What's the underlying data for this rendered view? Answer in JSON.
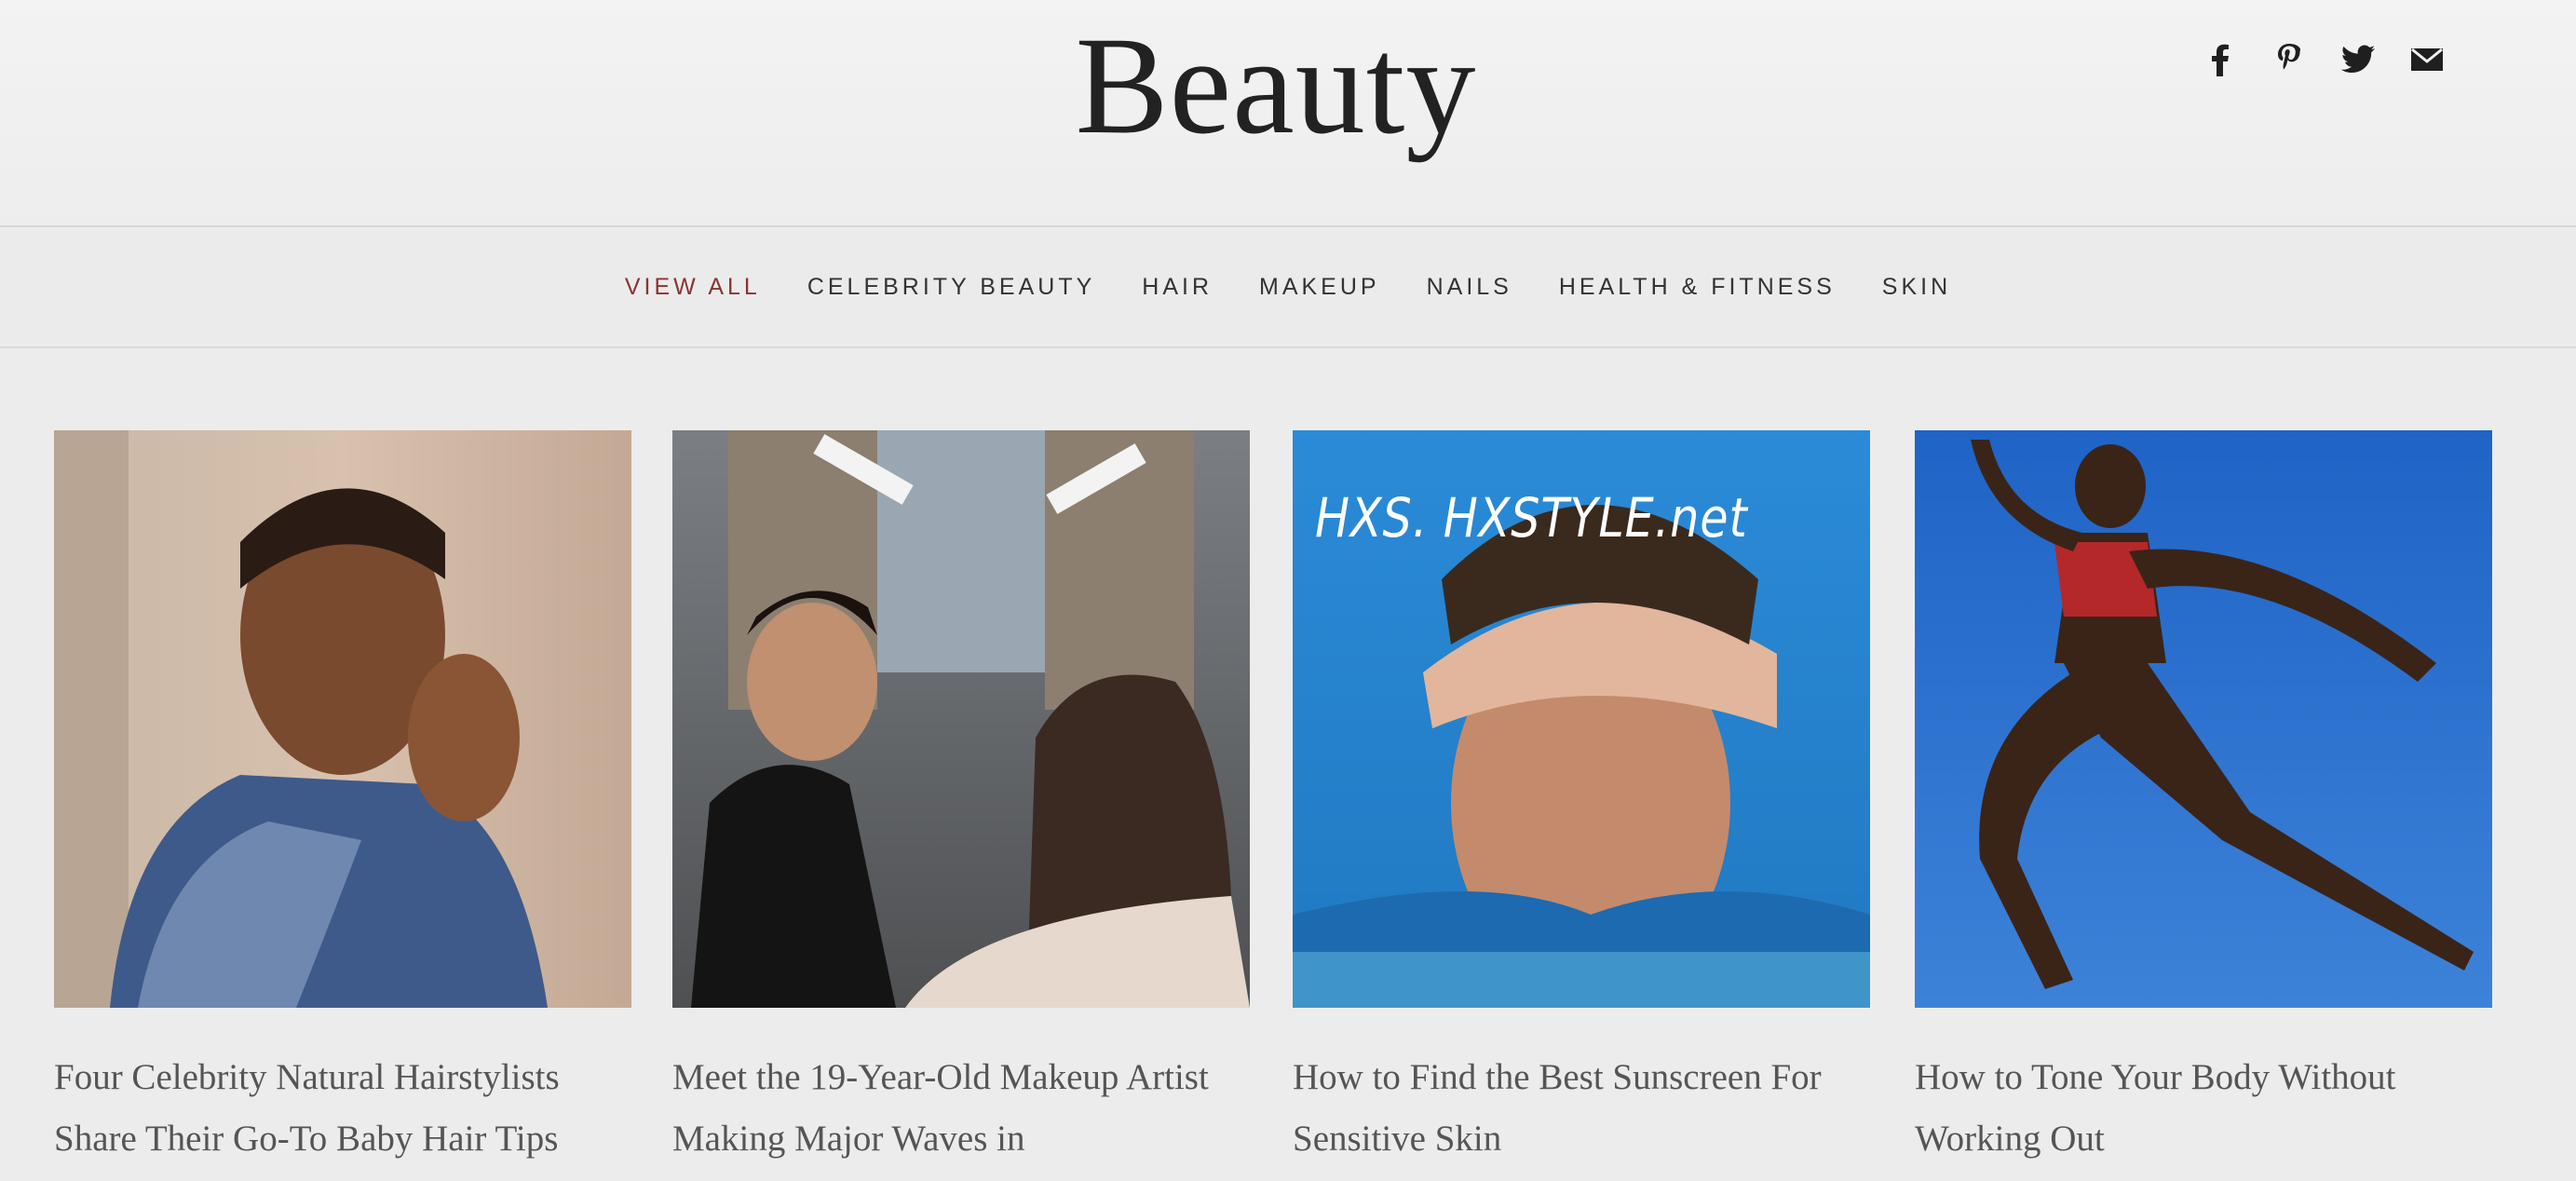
{
  "site": {
    "title": "Beauty"
  },
  "social": [
    {
      "icon": "facebook-icon"
    },
    {
      "icon": "pinterest-icon"
    },
    {
      "icon": "twitter-icon"
    },
    {
      "icon": "email-icon"
    }
  ],
  "nav": {
    "items": [
      {
        "label": "VIEW ALL",
        "active": true
      },
      {
        "label": "CELEBRITY BEAUTY"
      },
      {
        "label": "HAIR"
      },
      {
        "label": "MAKEUP"
      },
      {
        "label": "NAILS"
      },
      {
        "label": "HEALTH & FITNESS"
      },
      {
        "label": "SKIN"
      }
    ]
  },
  "articles": [
    {
      "title": "Four Celebrity Natural Hairstylists Share Their Go-To Baby Hair Tips"
    },
    {
      "title": "Meet the 19-Year-Old Makeup Artist Making Major Waves in"
    },
    {
      "title": "How to Find the Best Sunscreen For Sensitive Skin",
      "watermark": "HXS. HXSTYLE.net"
    },
    {
      "title": "How to Tone Your Body Without Working Out"
    }
  ],
  "colors": {
    "accent": "#8a3333",
    "background": "#ececec"
  }
}
